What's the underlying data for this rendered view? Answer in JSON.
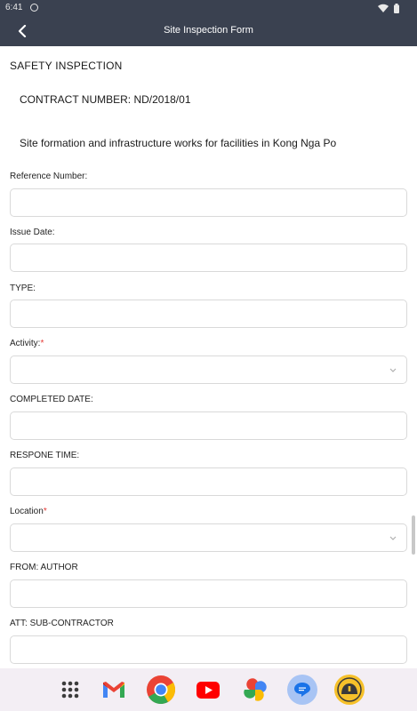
{
  "status": {
    "time": "6:41"
  },
  "app_bar": {
    "title": "Site Inspection Form"
  },
  "form": {
    "section_title": "SAFETY INSPECTION",
    "contract": "CONTRACT NUMBER: ND/2018/01",
    "project": "Site formation and infrastructure works for facilities in Kong Nga Po",
    "fields": [
      {
        "label": "Reference Number:",
        "value": ""
      },
      {
        "label": "Issue Date:",
        "value": ""
      },
      {
        "label": "TYPE:",
        "value": ""
      },
      {
        "label": "Activity:",
        "required_mark": "*",
        "value": ""
      },
      {
        "label": "COMPLETED DATE:",
        "value": ""
      },
      {
        "label": "RESPONE TIME:",
        "value": ""
      },
      {
        "label": "Location",
        "required_mark": "*",
        "value": ""
      },
      {
        "label": "FROM: AUTHOR",
        "value": ""
      },
      {
        "label": "ATT: SUB-CONTRACTOR",
        "value": ""
      }
    ]
  },
  "icons": {
    "back": "chevron-left-icon",
    "dropdown": "chevron-down-icon",
    "dock": [
      "app-grid-icon",
      "gmail-icon",
      "chrome-icon",
      "youtube-icon",
      "photos-icon",
      "messages-icon",
      "construction-app-icon"
    ]
  },
  "colors": {
    "header": "#3a4150",
    "required": "#e53935",
    "dock": "#f3eef4"
  }
}
